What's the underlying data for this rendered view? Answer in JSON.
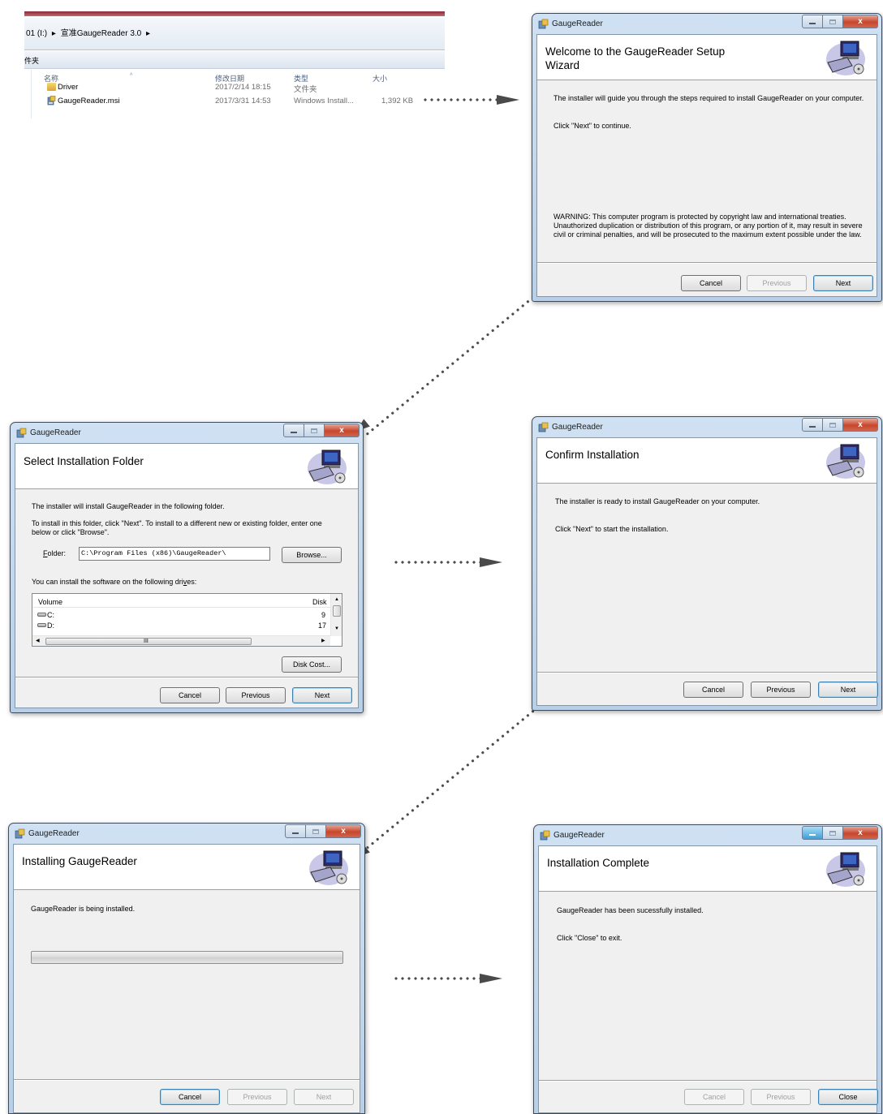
{
  "explorer": {
    "path_drive": "01 (I:)",
    "path_sep1": "▸",
    "path_folder": "宣准GaugeReader 3.0",
    "path_sep2": "▸",
    "new_folder": "件夹",
    "columns": {
      "name": "名称",
      "date": "修改日期",
      "type": "类型",
      "size": "大小"
    },
    "files": [
      {
        "name": "Driver",
        "date": "2017/2/14 18:15",
        "type": "文件夹",
        "size": ""
      },
      {
        "name": "GaugeReader.msi",
        "date": "2017/3/31 14:53",
        "type": "Windows Install...",
        "size": "1,392 KB"
      }
    ]
  },
  "windows": {
    "app_title": "GaugeReader",
    "welcome": {
      "title_line1": "Welcome to the GaugeReader Setup",
      "title_line2": "Wizard",
      "intro": "The installer will guide you through the steps required to install GaugeReader on your computer.",
      "continue": "Click \"Next\" to continue.",
      "warning_l1": "WARNING: This computer program is protected by copyright law and international treaties.",
      "warning_l2": "Unauthorized duplication or distribution of this program, or any portion of it, may result in severe",
      "warning_l3": "civil or criminal penalties, and will be prosecuted to the maximum extent possible under the law.",
      "cancel": "Cancel",
      "previous": "Previous",
      "next": "Next"
    },
    "folder": {
      "title": "Select Installation Folder",
      "line1": "The installer will install GaugeReader in the following folder.",
      "line2": "To install in this folder, click \"Next\". To install to a different new or existing folder, enter one",
      "line3": "below or click \"Browse\".",
      "folder_label_u": "F",
      "folder_label_rest": "older:",
      "folder_value": "C:\\Program Files (x86)\\GaugeReader\\",
      "browse": "Browse...",
      "drives_label_a": "You can install the software on the following dri",
      "drives_label_u": "v",
      "drives_label_b": "es:",
      "col_volume": "Volume",
      "col_disk": "Disk",
      "drives": [
        {
          "name": "C:",
          "disk": "9"
        },
        {
          "name": "D:",
          "disk": "17"
        }
      ],
      "scroll_mark": "III",
      "disk_cost": "Disk Cost...",
      "cancel": "Cancel",
      "previous": "Previous",
      "next": "Next"
    },
    "confirm": {
      "title": "Confirm Installation",
      "line1": "The installer is ready to install GaugeReader on your computer.",
      "line2": "Click \"Next\" to start the installation.",
      "cancel": "Cancel",
      "previous": "Previous",
      "next": "Next"
    },
    "installing": {
      "title": "Installing GaugeReader",
      "line1": "GaugeReader is being installed.",
      "progress": 0,
      "cancel": "Cancel",
      "previous": "Previous",
      "next": "Next"
    },
    "complete": {
      "title": "Installation Complete",
      "line1": "GaugeReader has been sucessfully installed.",
      "line2": "Click \"Close\" to exit.",
      "cancel": "Cancel",
      "previous": "Previous",
      "close": "Close"
    }
  },
  "colors": {
    "arrow": "#4a4a4a",
    "close_button": "#c7462d",
    "title_bar": "#b7cfe8"
  }
}
